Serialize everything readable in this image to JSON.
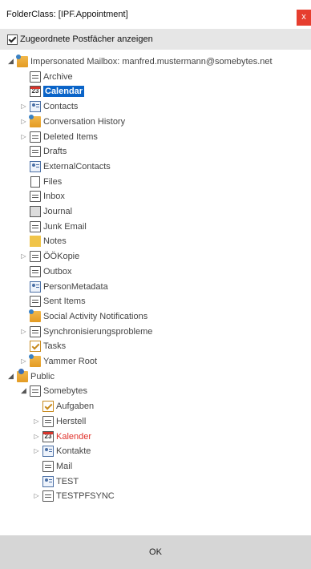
{
  "window": {
    "title": "FolderClass: [IPF.Appointment]",
    "close_label": "x"
  },
  "option": {
    "label": "Zugeordnete Postfächer anzeigen",
    "checked": true
  },
  "tree": [
    {
      "id": "mailbox",
      "label": "Impersonated Mailbox: manfred.mustermann@somebytes.net",
      "icon": "mailbox-icon",
      "expand": "open"
    },
    {
      "id": "archive",
      "label": "Archive",
      "icon": "folder-icon",
      "expand": "none"
    },
    {
      "id": "calendar",
      "label": "Calendar",
      "icon": "calendar-icon",
      "expand": "none",
      "selected": true
    },
    {
      "id": "contacts",
      "label": "Contacts",
      "icon": "contact-icon",
      "expand": "closed"
    },
    {
      "id": "conversation-history",
      "label": "Conversation History",
      "icon": "mailbox-icon",
      "expand": "closed"
    },
    {
      "id": "deleted-items",
      "label": "Deleted Items",
      "icon": "folder-icon",
      "expand": "closed"
    },
    {
      "id": "drafts",
      "label": "Drafts",
      "icon": "folder-icon",
      "expand": "none"
    },
    {
      "id": "externalcontacts",
      "label": "ExternalContacts",
      "icon": "contact-icon",
      "expand": "none"
    },
    {
      "id": "files",
      "label": "Files",
      "icon": "file-icon",
      "expand": "none"
    },
    {
      "id": "inbox",
      "label": "Inbox",
      "icon": "folder-icon",
      "expand": "none"
    },
    {
      "id": "journal",
      "label": "Journal",
      "icon": "journal-icon",
      "expand": "none"
    },
    {
      "id": "junk-email",
      "label": "Junk Email",
      "icon": "folder-icon",
      "expand": "none"
    },
    {
      "id": "notes",
      "label": "Notes",
      "icon": "notes-icon",
      "expand": "none"
    },
    {
      "id": "oekopie",
      "label": "ÖÖKopie",
      "icon": "folder-icon",
      "expand": "closed"
    },
    {
      "id": "outbox",
      "label": "Outbox",
      "icon": "folder-icon",
      "expand": "none"
    },
    {
      "id": "personmetadata",
      "label": "PersonMetadata",
      "icon": "contact-icon",
      "expand": "none"
    },
    {
      "id": "sent-items",
      "label": "Sent Items",
      "icon": "folder-icon",
      "expand": "none"
    },
    {
      "id": "social-activity",
      "label": "Social Activity Notifications",
      "icon": "mailbox-icon",
      "expand": "none"
    },
    {
      "id": "sync-problems",
      "label": "Synchronisierungsprobleme",
      "icon": "folder-icon",
      "expand": "closed"
    },
    {
      "id": "tasks",
      "label": "Tasks",
      "icon": "tasks-icon",
      "expand": "none"
    },
    {
      "id": "yammer-root",
      "label": "Yammer Root",
      "icon": "mailbox-icon",
      "expand": "closed"
    },
    {
      "id": "public",
      "label": "Public",
      "icon": "public-folder-icon",
      "expand": "open"
    },
    {
      "id": "somebytes",
      "label": "Somebytes",
      "icon": "folder-icon",
      "expand": "open"
    },
    {
      "id": "aufgaben",
      "label": "Aufgaben",
      "icon": "tasks-icon",
      "expand": "none"
    },
    {
      "id": "herstell",
      "label": "Herstell",
      "icon": "folder-icon",
      "expand": "closed"
    },
    {
      "id": "kalender",
      "label": "Kalender",
      "icon": "calendar-icon",
      "expand": "closed",
      "highlight": "red"
    },
    {
      "id": "kontakte",
      "label": "Kontakte",
      "icon": "contact-icon",
      "expand": "closed"
    },
    {
      "id": "mail",
      "label": "Mail",
      "icon": "folder-icon",
      "expand": "none"
    },
    {
      "id": "test",
      "label": "TEST",
      "icon": "contact-icon",
      "expand": "none"
    },
    {
      "id": "testpfsync",
      "label": "TESTPFSYNC",
      "icon": "folder-icon",
      "expand": "closed"
    }
  ],
  "calendar_icon_text": "23",
  "footer": {
    "ok_label": "OK"
  },
  "colors": {
    "selection": "#0a64c8",
    "close": "#e63e2f",
    "highlight_red": "#e0322b"
  }
}
